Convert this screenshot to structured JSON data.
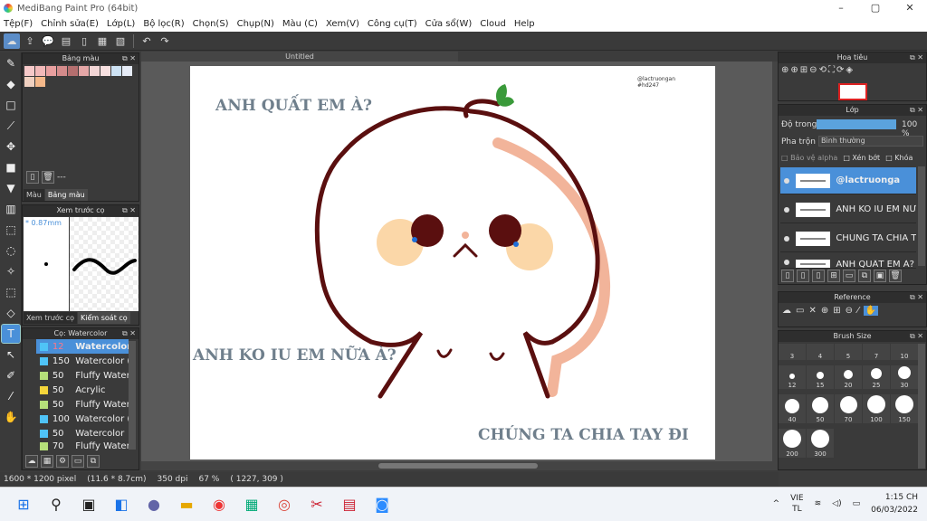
{
  "app": {
    "title": "MediBang Paint Pro (64bit)"
  },
  "window": {
    "minimize": "–",
    "maximize": "▢",
    "close": "✕"
  },
  "menu": [
    "Tệp(F)",
    "Chỉnh sửa(E)",
    "Lớp(L)",
    "Bộ lọc(R)",
    "Chọn(S)",
    "Chụp(N)",
    "Màu (C)",
    "Xem(V)",
    "Công cụ(T)",
    "Cửa sổ(W)",
    "Cloud",
    "Help"
  ],
  "color_panel": {
    "title": "Bảng màu",
    "tabs": [
      "Màu",
      "Bảng màu"
    ],
    "dots": "---",
    "swatches": [
      "#f6c9c9",
      "#f2b9b9",
      "#e89f9f",
      "#d48b8b",
      "#b56f6f",
      "#e4a6a6",
      "#f3d6d6",
      "#f8e1e1",
      "#cde2f3",
      "#e6ecf7",
      "#f0d0c0",
      "#f5b88a"
    ]
  },
  "brush_preview": {
    "title": "Xem trước cọ",
    "size": "* 0.87mm",
    "tabs": [
      "Xem trước cọ",
      "Kiểm soát cọ"
    ]
  },
  "brush_panel": {
    "title": "Cọ: Watercolor",
    "items": [
      {
        "size": "12",
        "name": "Watercolor",
        "color": "#4fc3f7",
        "selected": true
      },
      {
        "size": "150",
        "name": "Watercolor (",
        "color": "#4fc3f7"
      },
      {
        "size": "50",
        "name": "Fluffy Water",
        "color": "#b5e07a"
      },
      {
        "size": "50",
        "name": "Acrylic",
        "color": "#f5d53a"
      },
      {
        "size": "50",
        "name": "Fluffy Water",
        "color": "#b5e07a"
      },
      {
        "size": "100",
        "name": "Watercolor (",
        "color": "#4fc3f7"
      },
      {
        "size": "50",
        "name": "Watercolor",
        "color": "#4fc3f7"
      },
      {
        "size": "70",
        "name": "Fluffy Water",
        "color": "#b5e07a"
      }
    ]
  },
  "document": {
    "tab": "Untitled"
  },
  "canvas_text": {
    "watermark1": "@lactruongan",
    "watermark2": "#hd247",
    "line1": "ANH QUẤT EM À?",
    "line2": "ANH KO IU EM NỮA À?",
    "line3": "CHÚNG TA CHIA TAY ĐI"
  },
  "status": {
    "size": "1600 * 1200 pixel",
    "dims": "(11.6 * 8.7cm)",
    "dpi": "350 dpi",
    "zoom": "67 %",
    "pos": "( 1227, 309 )"
  },
  "navigator": {
    "title": "Hoa tiêu"
  },
  "layer_panel": {
    "title": "Lớp",
    "opacity_label": "Độ trong",
    "opacity_value": "100 %",
    "blend_label": "Pha trộn",
    "blend_value": "Bình thường",
    "opt_alpha": "Bảo vệ alpha",
    "opt_clip": "Xén bớt",
    "opt_lock": "Khóa",
    "layers": [
      {
        "name": "@lactruonga",
        "selected": true
      },
      {
        "name": "ANH KO IU EM NỮ"
      },
      {
        "name": "CHÚNG TA CHIA T"
      },
      {
        "name": "ANH QUẤT EM À?"
      }
    ]
  },
  "reference": {
    "title": "Reference"
  },
  "brush_size": {
    "title": "Brush Size",
    "sizes": [
      "3",
      "4",
      "5",
      "7",
      "10",
      "12",
      "15",
      "20",
      "25",
      "30",
      "40",
      "50",
      "70",
      "100",
      "150",
      "200",
      "300"
    ]
  },
  "taskbar": {
    "lang1": "VIE",
    "lang2": "TL",
    "time": "1:15 CH",
    "date": "06/03/2022"
  }
}
